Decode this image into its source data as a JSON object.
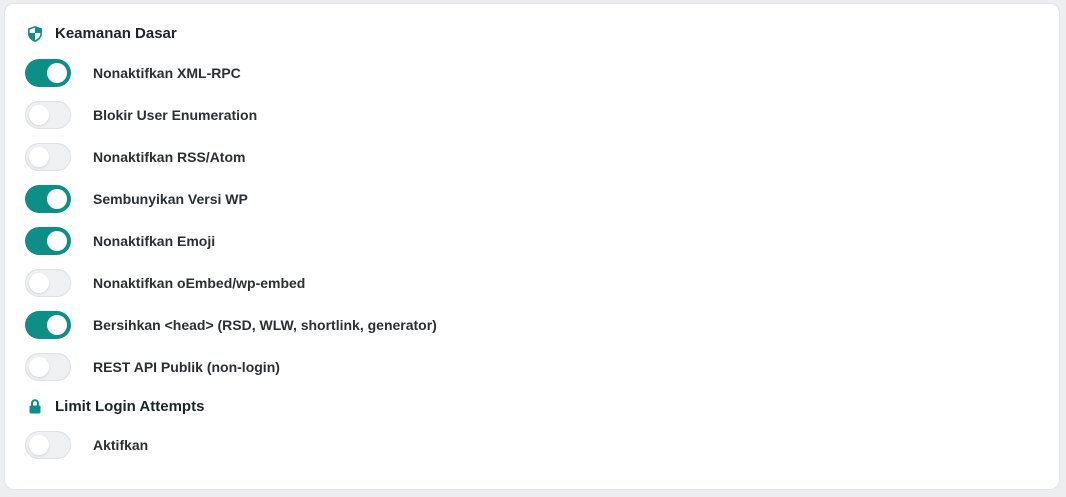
{
  "sections": [
    {
      "title": "Keamanan Dasar",
      "icon": "shield-icon",
      "items": [
        {
          "label": "Nonaktifkan XML-RPC",
          "on": true
        },
        {
          "label": "Blokir User Enumeration",
          "on": false
        },
        {
          "label": "Nonaktifkan RSS/Atom",
          "on": false
        },
        {
          "label": "Sembunyikan Versi WP",
          "on": true
        },
        {
          "label": "Nonaktifkan Emoji",
          "on": true
        },
        {
          "label": "Nonaktifkan oEmbed/wp-embed",
          "on": false
        },
        {
          "label": "Bersihkan <head> (RSD, WLW, shortlink, generator)",
          "on": true
        },
        {
          "label": "REST API Publik (non-login)",
          "on": false
        }
      ]
    },
    {
      "title": "Limit Login Attempts",
      "icon": "lock-icon",
      "items": [
        {
          "label": "Aktifkan",
          "on": false
        }
      ]
    }
  ],
  "colors": {
    "accent": "#0d8f88",
    "toggle_off": "#eef0f2"
  }
}
